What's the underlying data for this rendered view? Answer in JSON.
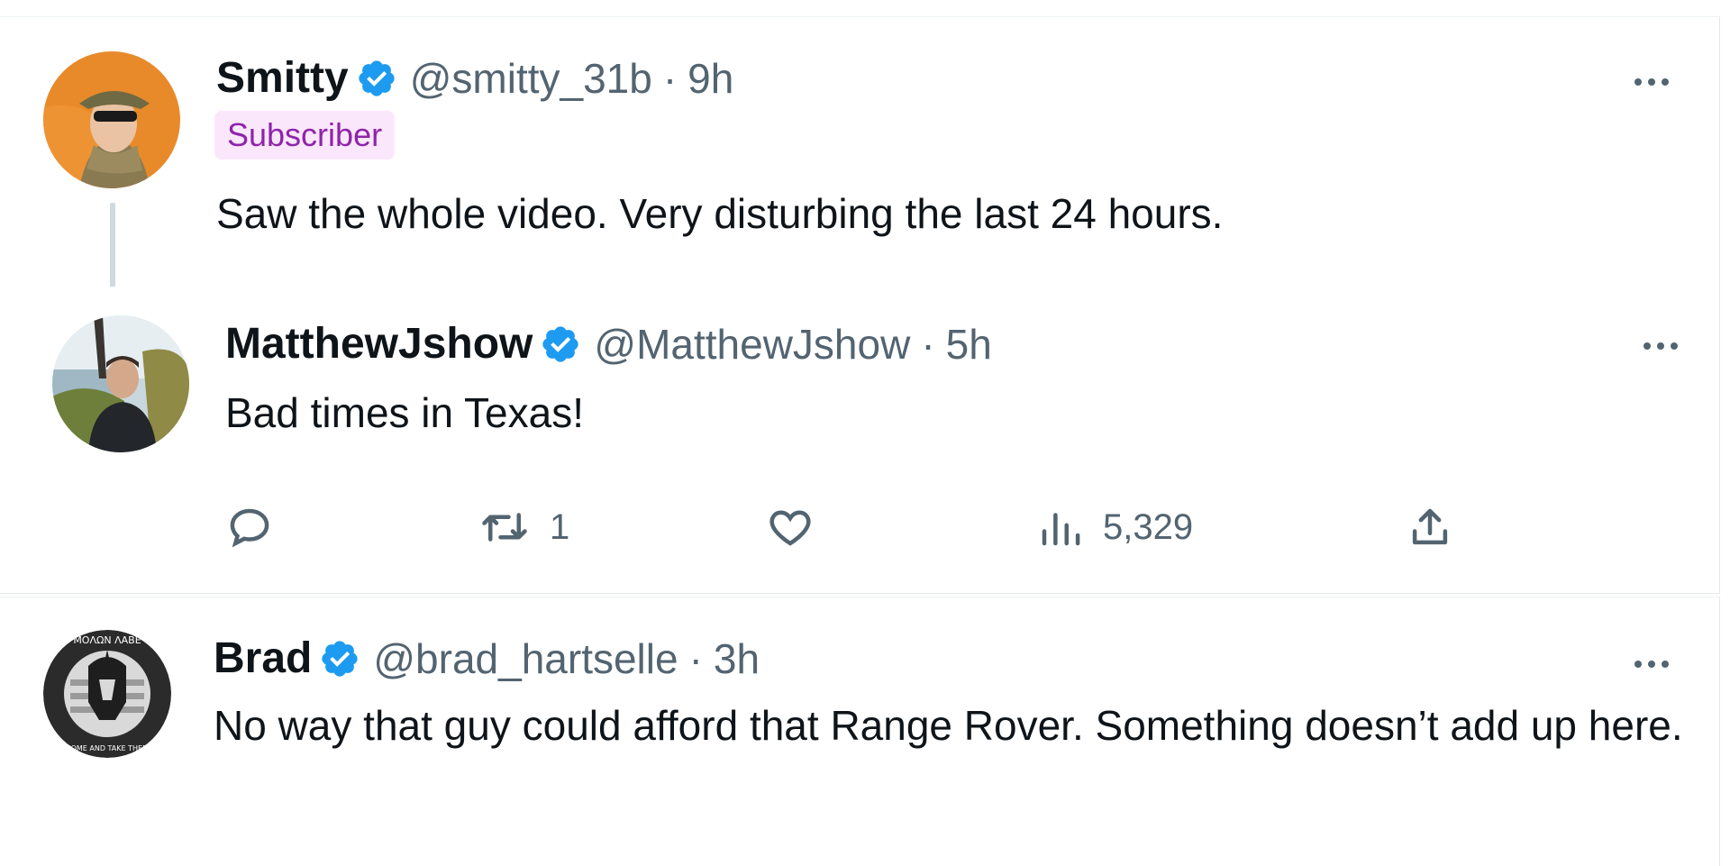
{
  "tweets": [
    {
      "name": "Smitty",
      "handle": "@smitty_31b",
      "separator": "·",
      "time": "9h",
      "badge": "Subscriber",
      "text": "Saw the whole video. Very disturbing the last 24 hours.",
      "verified": true
    },
    {
      "name": "MatthewJshow",
      "handle": "@MatthewJshow",
      "separator": "·",
      "time": "5h",
      "text": "Bad times in Texas!",
      "verified": true,
      "actions": {
        "reply_count": "",
        "retweet_count": "1",
        "like_count": "",
        "views_count": "5,329"
      }
    },
    {
      "name": "Brad",
      "handle": "@brad_hartselle",
      "separator": "·",
      "time": "3h",
      "text": "No way that guy could afford that Range Rover. Something doesn’t add up here.",
      "verified": true
    }
  ],
  "avatar3": {
    "seal_top": "ΜΟΛΩΝ ΛΑΒΕ",
    "seal_bottom": "COME AND TAKE THEM"
  },
  "colors": {
    "verified": "#1d9bf0",
    "secondary_text": "#536471",
    "badge_bg": "#fbe7fb",
    "badge_text": "#8e24aa"
  },
  "icons": [
    "verified-icon",
    "more-icon",
    "reply-icon",
    "retweet-icon",
    "like-icon",
    "views-icon",
    "share-icon"
  ]
}
